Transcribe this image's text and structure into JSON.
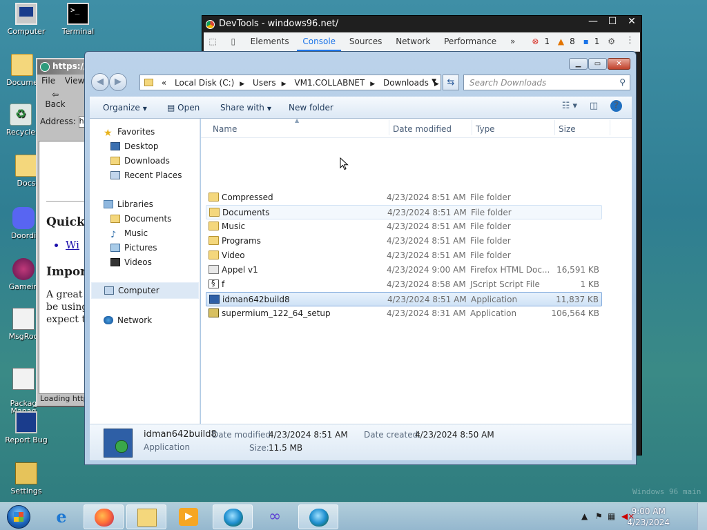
{
  "desktop": {
    "icons": [
      {
        "label": "Computer",
        "icon": "computer-icon"
      },
      {
        "label": "Terminal",
        "icon": "terminal-icon"
      },
      {
        "label": "Docume",
        "icon": "folder-icon"
      },
      {
        "label": "Recycle",
        "icon": "recycle-bin-icon"
      },
      {
        "label": "Docs",
        "icon": "folder-icon"
      },
      {
        "label": "Doordi",
        "icon": "discord-icon"
      },
      {
        "label": "Gamein",
        "icon": "game-icon"
      },
      {
        "label": "MsgRoo",
        "icon": "message-icon"
      },
      {
        "label": "Packag\nManag",
        "icon": "package-icon"
      },
      {
        "label": "Report Bug",
        "icon": "bug-report-icon"
      },
      {
        "label": "Settings",
        "icon": "settings-icon"
      }
    ],
    "watermark": "Windows 96 main"
  },
  "browser": {
    "title": "https://c",
    "menu": [
      "File",
      "View"
    ],
    "back_label": "Back",
    "address_label": "Address:",
    "address_value": "htt",
    "heading1": "Quick L",
    "link": "Wi",
    "heading2": "Import",
    "paragraph": [
      "A great n",
      "be using",
      "expect th"
    ],
    "status": "Loading https:"
  },
  "devtools": {
    "title": "DevTools - windows96.net/",
    "tabs": [
      "Elements",
      "Console",
      "Sources",
      "Network",
      "Performance"
    ],
    "active_tab": "Console",
    "more": "»",
    "errors": "1",
    "warnings": "8",
    "messages": "1"
  },
  "explorer": {
    "breadcrumb": [
      "Local Disk (C:)",
      "Users",
      "VM1.COLLABNET",
      "Downloads"
    ],
    "breadcrumb_prefix": "«",
    "search_placeholder": "Search Downloads",
    "commands": {
      "organize": "Organize",
      "open": "Open",
      "share_with": "Share with",
      "new_folder": "New folder"
    },
    "nav": {
      "favorites": "Favorites",
      "favorites_items": [
        "Desktop",
        "Downloads",
        "Recent Places"
      ],
      "libraries": "Libraries",
      "libraries_items": [
        "Documents",
        "Music",
        "Pictures",
        "Videos"
      ],
      "computer": "Computer",
      "network": "Network"
    },
    "columns": {
      "name": "Name",
      "date": "Date modified",
      "type": "Type",
      "size": "Size"
    },
    "files": [
      {
        "name": "Compressed",
        "date": "4/23/2024 8:51 AM",
        "type": "File folder",
        "size": "",
        "icon": "folder-icon"
      },
      {
        "name": "Documents",
        "date": "4/23/2024 8:51 AM",
        "type": "File folder",
        "size": "",
        "icon": "folder-icon"
      },
      {
        "name": "Music",
        "date": "4/23/2024 8:51 AM",
        "type": "File folder",
        "size": "",
        "icon": "folder-icon"
      },
      {
        "name": "Programs",
        "date": "4/23/2024 8:51 AM",
        "type": "File folder",
        "size": "",
        "icon": "folder-icon"
      },
      {
        "name": "Video",
        "date": "4/23/2024 8:51 AM",
        "type": "File folder",
        "size": "",
        "icon": "folder-icon"
      },
      {
        "name": "Appel v1",
        "date": "4/23/2024 9:00 AM",
        "type": "Firefox HTML Doc...",
        "size": "16,591 KB",
        "icon": "html-document-icon"
      },
      {
        "name": "f",
        "date": "4/23/2024 8:58 AM",
        "type": "JScript Script File",
        "size": "1 KB",
        "icon": "script-file-icon"
      },
      {
        "name": "idman642build8",
        "date": "4/23/2024 8:51 AM",
        "type": "Application",
        "size": "11,837 KB",
        "icon": "application-icon"
      },
      {
        "name": "supermium_122_64_setup",
        "date": "4/23/2024 8:31 AM",
        "type": "Application",
        "size": "106,564 KB",
        "icon": "installer-icon"
      }
    ],
    "details": {
      "name": "idman642build8",
      "kind": "Application",
      "modified_label": "Date modified:",
      "modified_value": "4/23/2024 8:51 AM",
      "created_label": "Date created:",
      "created_value": "4/23/2024 8:50 AM",
      "size_label": "Size:",
      "size_value": "11.5 MB"
    }
  },
  "taskbar": {
    "apps": [
      "internet-explorer-icon",
      "firefox-icon",
      "file-explorer-icon",
      "media-player-icon",
      "browser-globe-icon",
      "infinity-app-icon",
      "browser-globe-icon"
    ],
    "time": "9:00 AM",
    "date": "4/23/2024"
  }
}
